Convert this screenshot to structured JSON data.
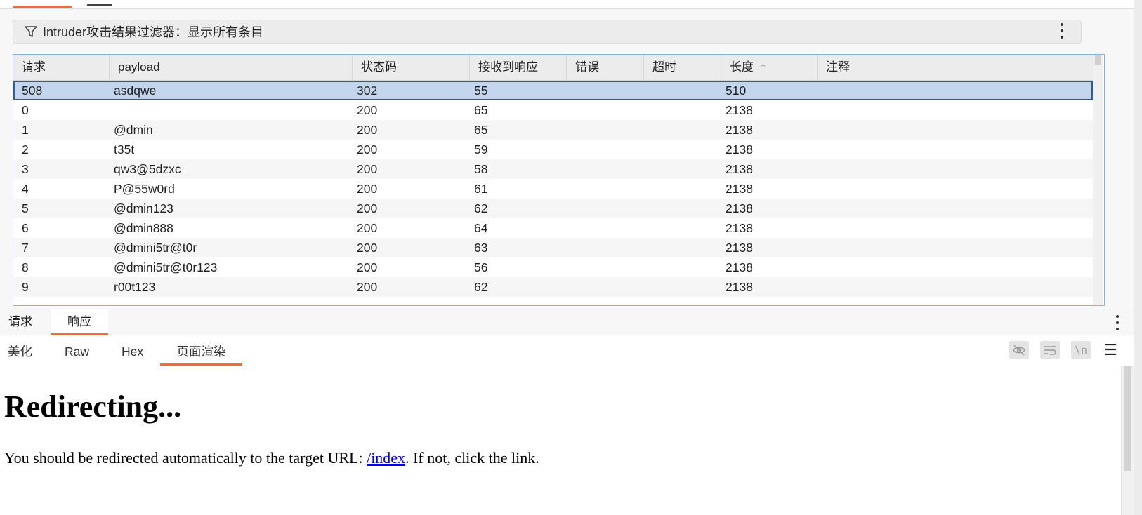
{
  "filter": {
    "label": "Intruder攻击结果过滤器：显示所有条目",
    "icon": "filter-icon"
  },
  "table": {
    "columns": [
      "请求",
      "payload",
      "状态码",
      "接收到响应",
      "错误",
      "超时",
      "长度",
      "注释"
    ],
    "sorted_column": "长度",
    "sort_direction": "ascending",
    "selected_row": 0,
    "rows": [
      [
        "508",
        "asdqwe",
        "302",
        "55",
        "",
        "",
        "510",
        ""
      ],
      [
        "0",
        "",
        "200",
        "65",
        "",
        "",
        "2138",
        ""
      ],
      [
        "1",
        "@dmin",
        "200",
        "65",
        "",
        "",
        "2138",
        ""
      ],
      [
        "2",
        "t35t",
        "200",
        "59",
        "",
        "",
        "2138",
        ""
      ],
      [
        "3",
        "qw3@5dzxc",
        "200",
        "58",
        "",
        "",
        "2138",
        ""
      ],
      [
        "4",
        "P@55w0rd",
        "200",
        "61",
        "",
        "",
        "2138",
        ""
      ],
      [
        "5",
        "@dmin123",
        "200",
        "62",
        "",
        "",
        "2138",
        ""
      ],
      [
        "6",
        "@dmin888",
        "200",
        "64",
        "",
        "",
        "2138",
        ""
      ],
      [
        "7",
        "@dmini5tr@t0r",
        "200",
        "63",
        "",
        "",
        "2138",
        ""
      ],
      [
        "8",
        "@dmini5tr@t0r123",
        "200",
        "56",
        "",
        "",
        "2138",
        ""
      ],
      [
        "9",
        "r00t123",
        "200",
        "62",
        "",
        "",
        "2138",
        ""
      ]
    ]
  },
  "bottom_tabs": {
    "request": "请求",
    "response": "响应",
    "active": "响应"
  },
  "sub_tabs": {
    "pretty": "美化",
    "raw": "Raw",
    "hex": "Hex",
    "render": "页面渲染",
    "active": "页面渲染"
  },
  "toolbar": {
    "hide_icon": "eye-off-icon",
    "wrap_icon": "wrap-lines-icon",
    "newline_label": "\\n",
    "menu_icon": "hamburger-menu-icon"
  },
  "render": {
    "heading": "Redirecting...",
    "text_before": "You should be redirected automatically to the target URL: ",
    "link": "/index",
    "text_after": ". If not, click the link."
  },
  "colors": {
    "accent": "#f26a35",
    "selection": "#c3d6ee",
    "selection_border": "#2a5d9b",
    "link": "#0000ee"
  }
}
